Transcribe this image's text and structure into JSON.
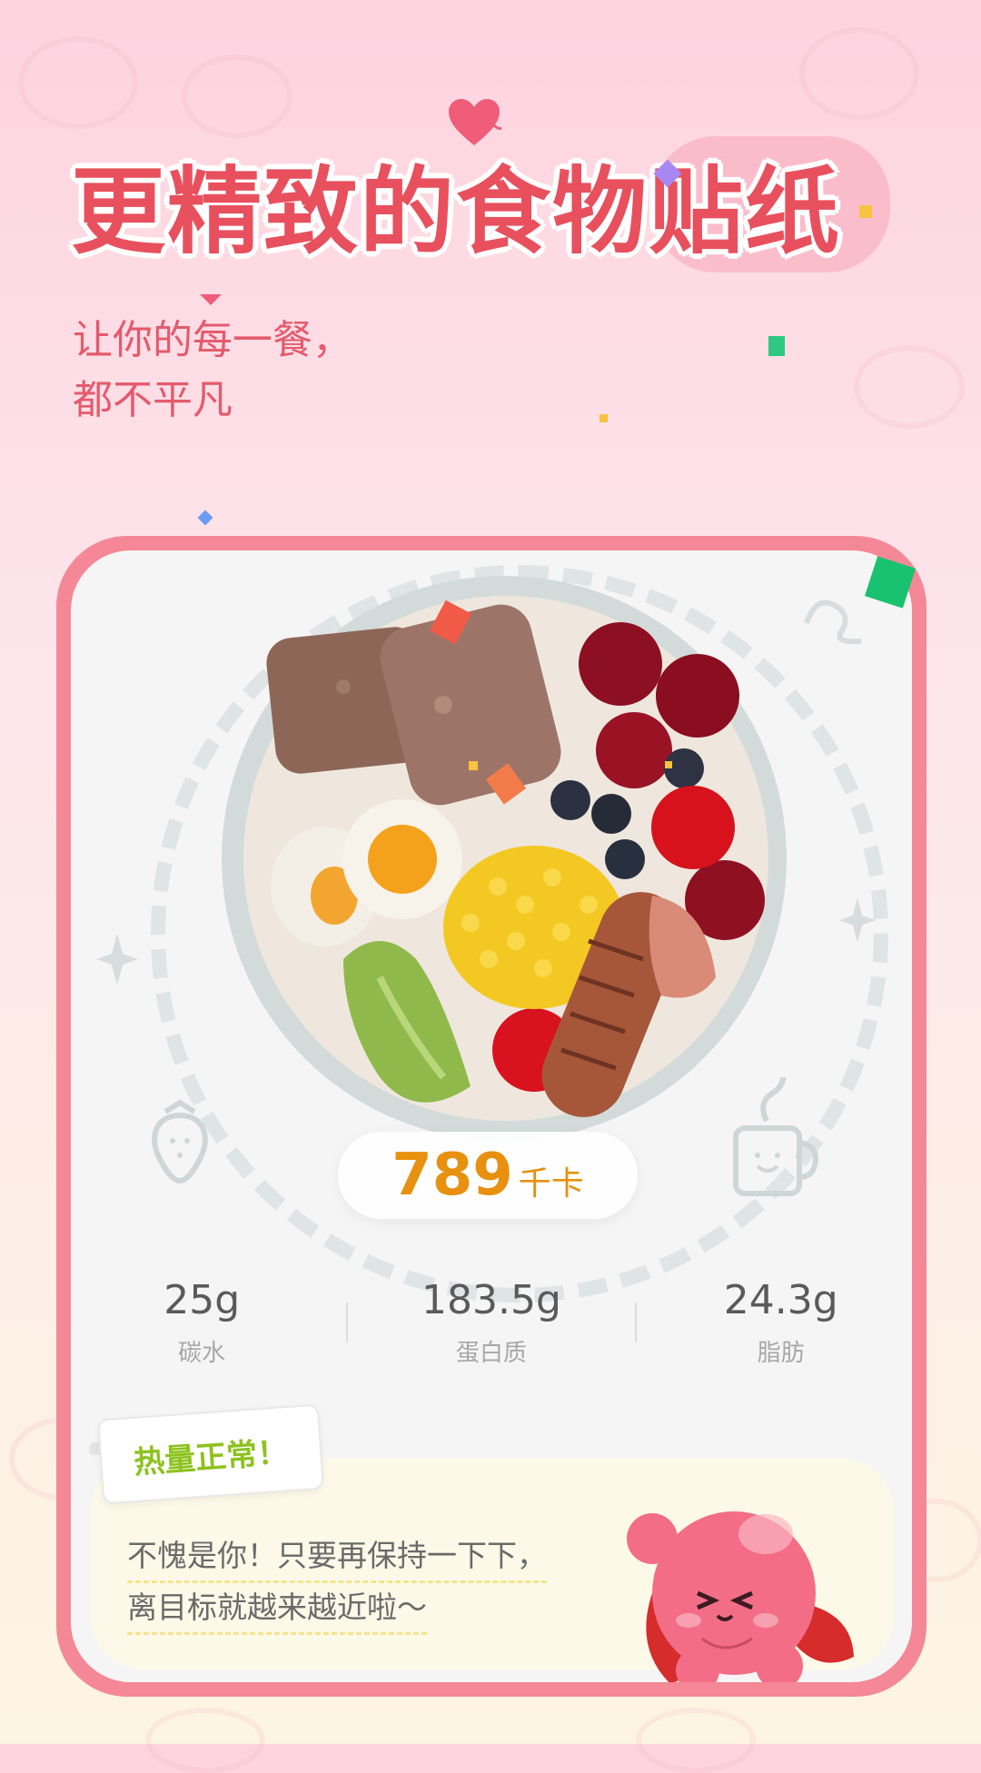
{
  "header": {
    "title": "更精致的食物贴纸",
    "subtitle_line1": "让你的每一餐，",
    "subtitle_line2": "都不平凡"
  },
  "meal": {
    "calories_value": "789",
    "calories_unit": "千卡",
    "macros": [
      {
        "value": "25g",
        "label": "碳水"
      },
      {
        "value": "183.5g",
        "label": "蛋白质"
      },
      {
        "value": "24.3g",
        "label": "脂肪"
      }
    ]
  },
  "status": {
    "label": "热量正常！",
    "comment_line1": "不愧是你！只要再保持一下下，",
    "comment_line2": "离目标就越来越近啦～"
  },
  "colors": {
    "accent": "#e8505e",
    "card_border": "#f48896",
    "calories": "#e8900f",
    "status_green": "#8dc21f"
  },
  "icons": [
    "heart-icon",
    "strawberry-doodle-icon",
    "mug-doodle-icon",
    "sparkle-doodle-icon",
    "mascot-icon"
  ]
}
